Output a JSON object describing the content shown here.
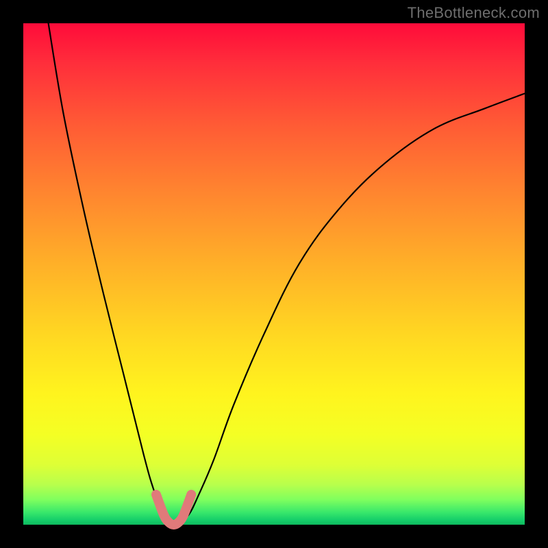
{
  "watermark": "TheBottleneck.com",
  "colors": {
    "frame": "#000000",
    "gradient_top": "#ff0b3a",
    "gradient_bottom": "#0fb95f",
    "curve": "#000000",
    "marker": "#e07a7a"
  },
  "chart_data": {
    "type": "line",
    "title": "",
    "xlabel": "",
    "ylabel": "",
    "xlim": [
      0,
      100
    ],
    "ylim": [
      0,
      100
    ],
    "grid": false,
    "legend": false,
    "series": [
      {
        "name": "bottleneck-curve",
        "x": [
          5,
          8,
          12,
          16,
          20,
          24,
          26,
          28,
          29,
          30,
          31,
          33,
          35,
          38,
          42,
          48,
          55,
          63,
          72,
          82,
          92,
          100
        ],
        "y": [
          100,
          82,
          63,
          46,
          30,
          14,
          7,
          2,
          0.5,
          0,
          0.5,
          2,
          6,
          13,
          24,
          38,
          52,
          63,
          72,
          79,
          83,
          86
        ]
      }
    ],
    "annotations": [
      {
        "name": "highlight-minimum",
        "type": "marker-segment",
        "x": [
          26.5,
          28,
          29,
          30,
          31,
          32,
          33.5
        ],
        "y": [
          6,
          2,
          0.5,
          0,
          0.5,
          2,
          6
        ]
      }
    ]
  }
}
